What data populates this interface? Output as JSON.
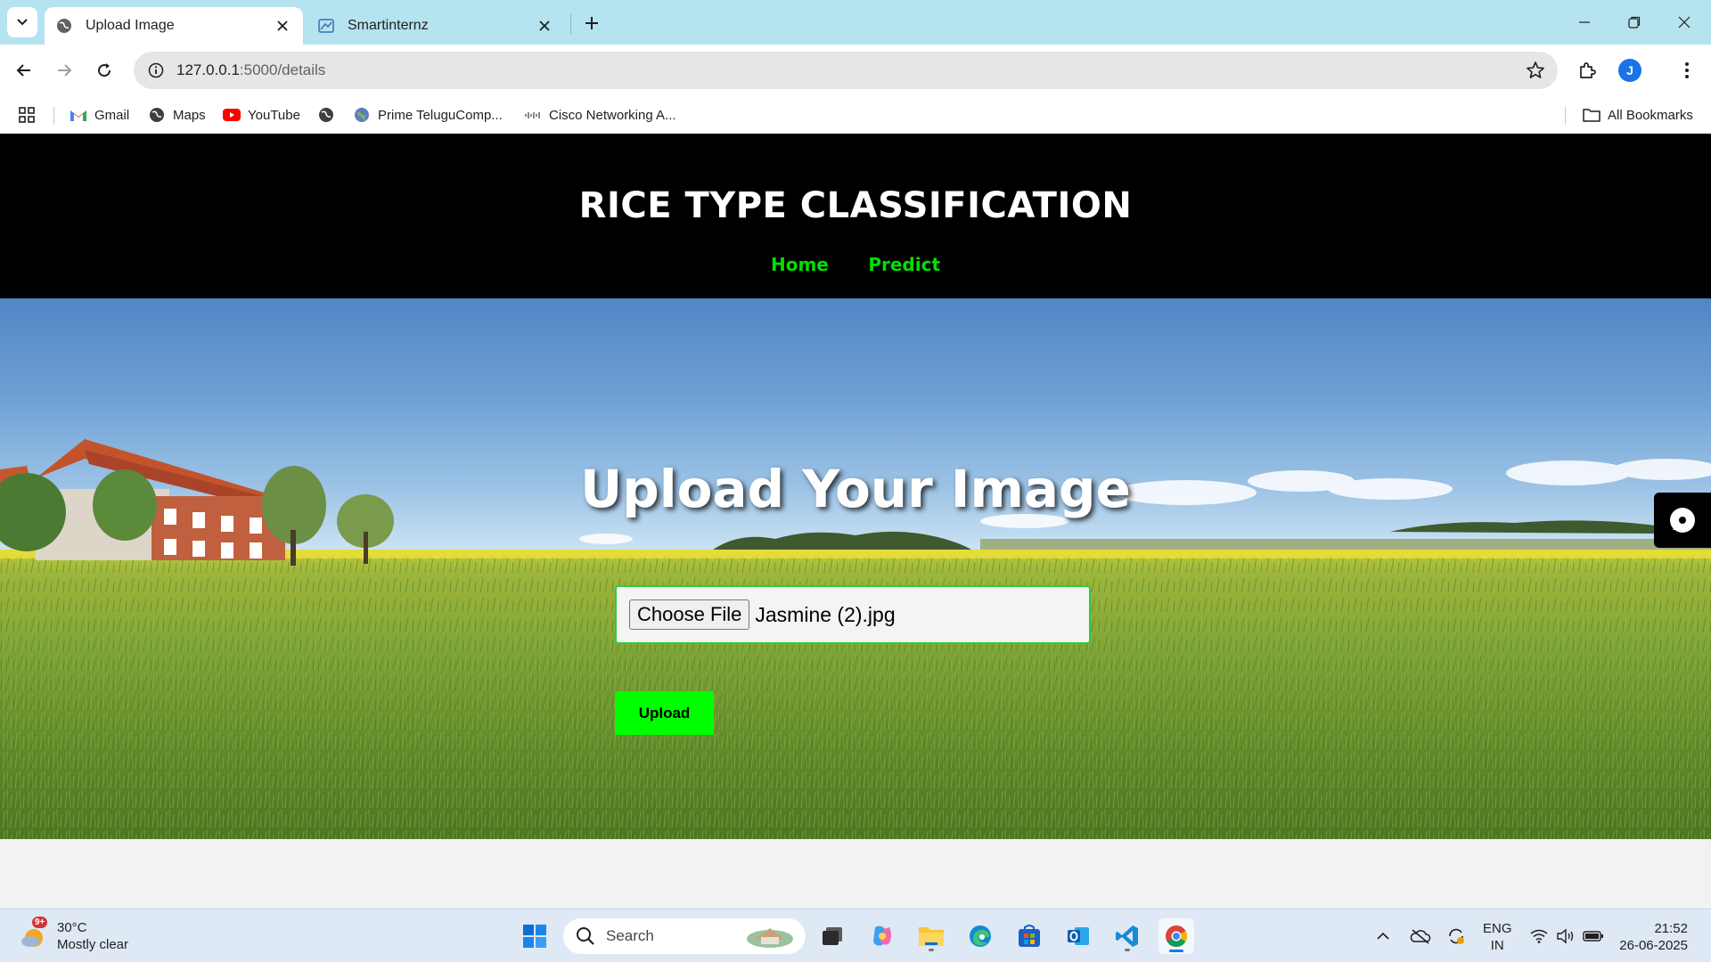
{
  "browser": {
    "tabs": [
      {
        "title": "Upload Image",
        "active": true
      },
      {
        "title": "Smartinternz",
        "active": false
      }
    ],
    "address": {
      "host": "127.0.0.1",
      "path": ":5000/details"
    },
    "profile_initial": "J",
    "bookmarks": [
      {
        "label": "Gmail"
      },
      {
        "label": "Maps"
      },
      {
        "label": "YouTube"
      },
      {
        "label": ""
      },
      {
        "label": "Prime TeluguComp..."
      },
      {
        "label": "Cisco Networking A..."
      }
    ],
    "all_bookmarks_label": "All Bookmarks"
  },
  "site": {
    "title": "RICE TYPE CLASSIFICATION",
    "nav": [
      {
        "label": "Home"
      },
      {
        "label": "Predict"
      }
    ],
    "hero_heading": "Upload Your Image",
    "file_input": {
      "button_label": "Choose File",
      "file_name": "Jasmine (2).jpg"
    },
    "upload_label": "Upload"
  },
  "taskbar": {
    "weather": {
      "temp": "30°C",
      "condition": "Mostly clear",
      "badge": "9+"
    },
    "search_placeholder": "Search",
    "language": {
      "line1": "ENG",
      "line2": "IN"
    },
    "clock": {
      "time": "21:52",
      "date": "26-06-2025"
    }
  },
  "colors": {
    "nav_link": "#00e000",
    "upload_button": "#00ff00",
    "header_bg": "#000000"
  }
}
